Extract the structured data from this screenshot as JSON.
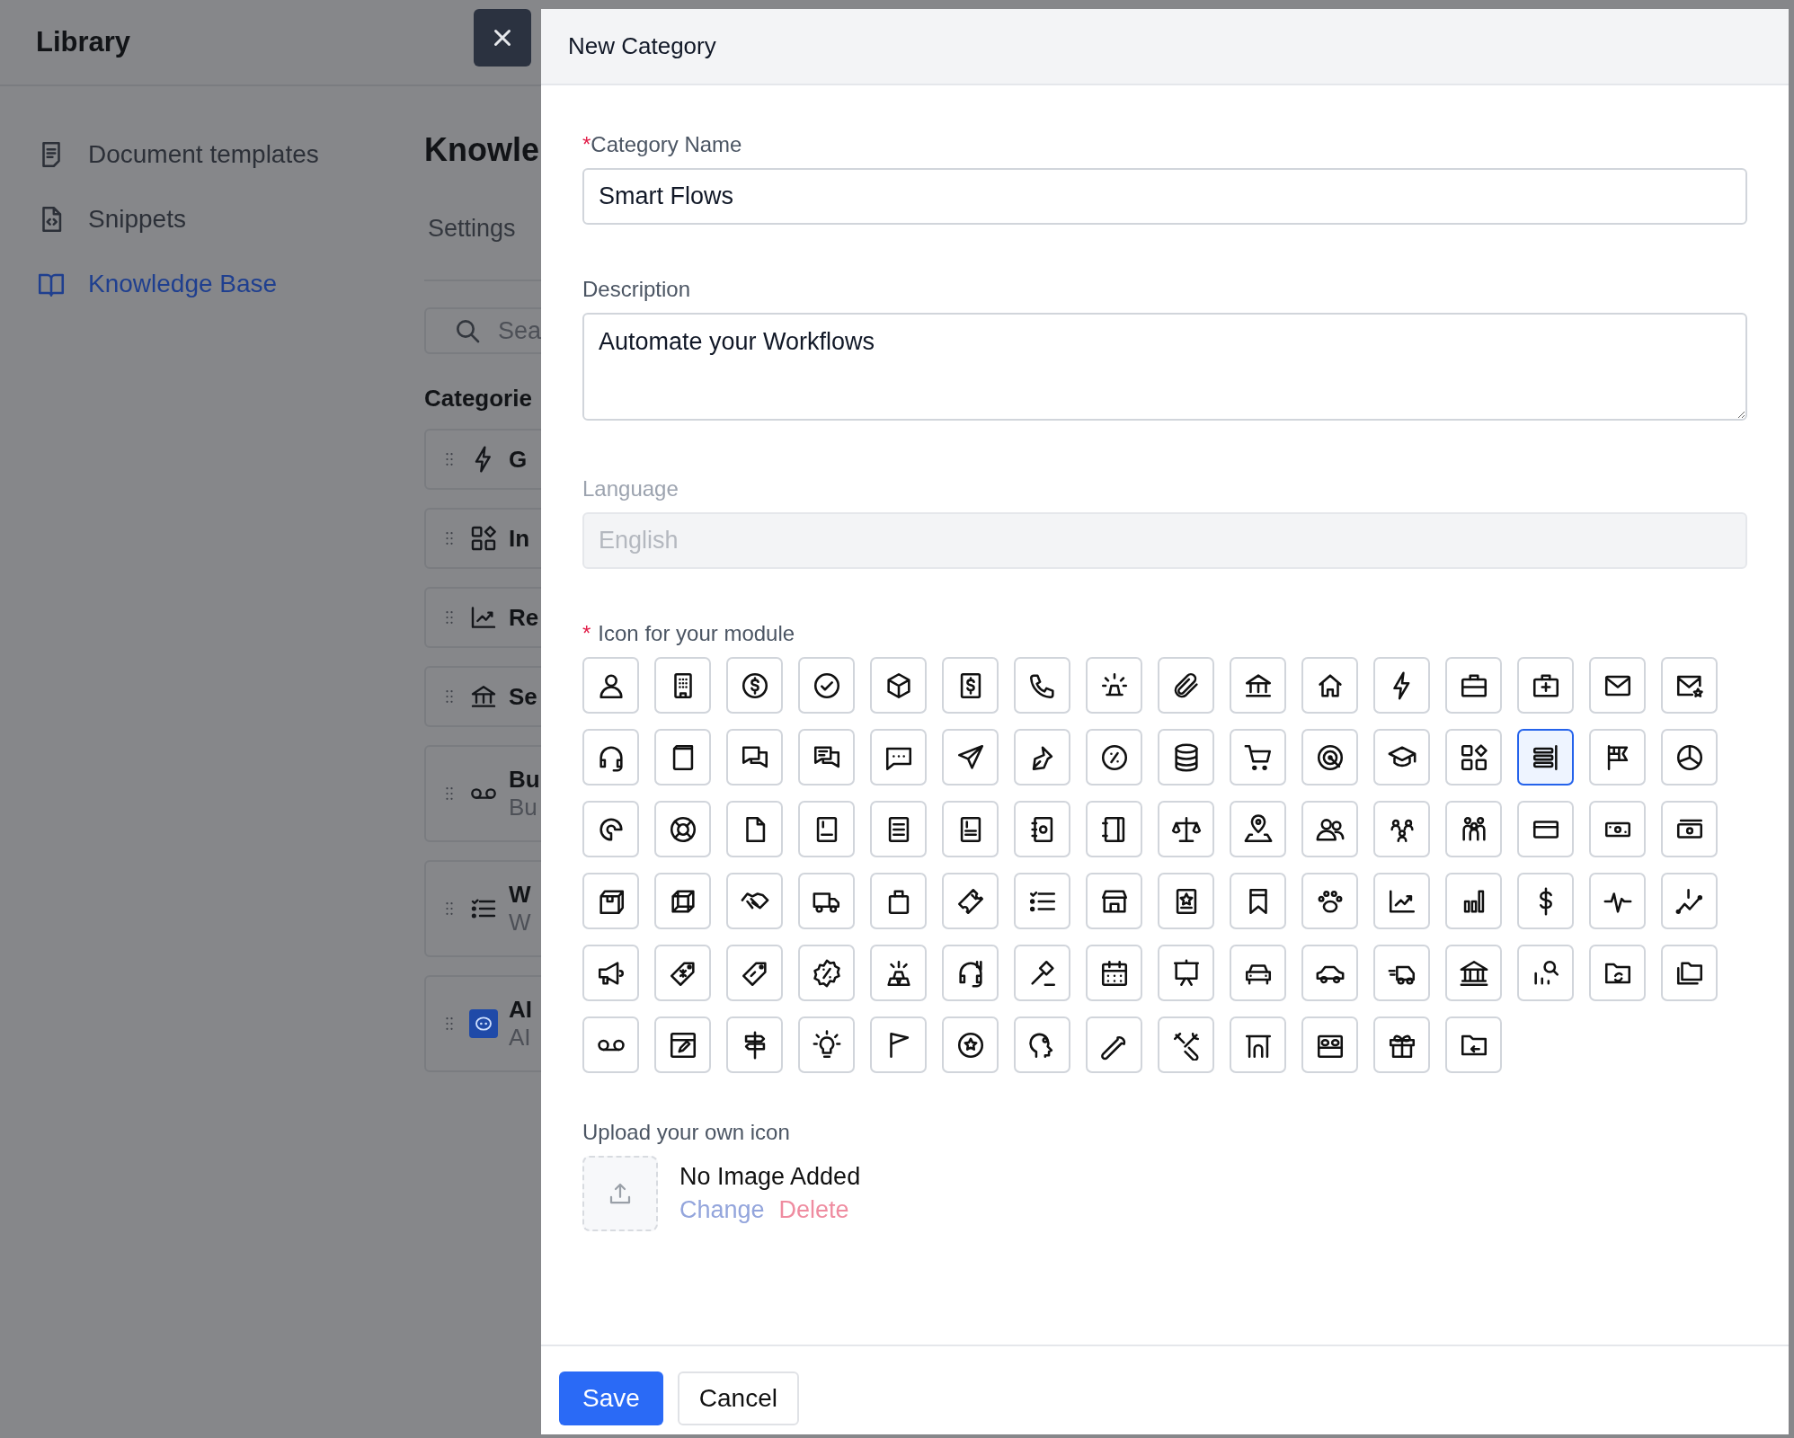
{
  "sidebar": {
    "title": "Library",
    "items": [
      {
        "label": "Document templates",
        "selected": false
      },
      {
        "label": "Snippets",
        "selected": false
      },
      {
        "label": "Knowledge Base",
        "selected": true
      }
    ]
  },
  "page": {
    "heading": "Knowle",
    "tabs": [
      {
        "label": "Settings"
      }
    ],
    "search": {
      "placeholder": "Sea"
    },
    "categories_heading": "Categorie",
    "categories": [
      {
        "title": "G"
      },
      {
        "title": "In"
      },
      {
        "title": "Re"
      },
      {
        "title": "Se"
      },
      {
        "title": "Bu",
        "subtitle": "Bu"
      },
      {
        "title": "W",
        "subtitle": "W"
      },
      {
        "title": "AI",
        "subtitle": "AI"
      }
    ]
  },
  "drawer": {
    "title": "New Category",
    "fields": [
      {
        "label": "Category Name",
        "marker": "*",
        "value": "Smart Flows",
        "kind": "text",
        "disabled": false
      },
      {
        "label": "Description",
        "value": "Automate your Workflows",
        "kind": "textarea",
        "disabled": false
      },
      {
        "label": "Language",
        "value": "English",
        "kind": "text",
        "disabled": true
      }
    ],
    "icon_picker": {
      "label": "Icon for your module",
      "marker": "*",
      "icons": [
        {
          "selected": false
        },
        {
          "selected": false
        },
        {
          "selected": false
        },
        {
          "selected": false
        },
        {
          "selected": false
        },
        {
          "selected": false
        },
        {
          "selected": false
        },
        {
          "selected": false
        },
        {
          "selected": false
        },
        {
          "selected": false
        },
        {
          "selected": false
        },
        {
          "selected": false
        },
        {
          "selected": false
        },
        {
          "selected": false
        },
        {
          "selected": false
        },
        {
          "selected": false
        },
        {
          "selected": false
        },
        {
          "selected": false
        },
        {
          "selected": false
        },
        {
          "selected": false
        },
        {
          "selected": false
        },
        {
          "selected": false
        },
        {
          "selected": false
        },
        {
          "selected": false
        },
        {
          "selected": false
        },
        {
          "selected": false
        },
        {
          "selected": false
        },
        {
          "selected": false
        },
        {
          "selected": false
        },
        {
          "selected": true
        },
        {
          "selected": false
        },
        {
          "selected": false
        },
        {
          "selected": false
        },
        {
          "selected": false
        },
        {
          "selected": false
        },
        {
          "selected": false
        },
        {
          "selected": false
        },
        {
          "selected": false
        },
        {
          "selected": false
        },
        {
          "selected": false
        },
        {
          "selected": false
        },
        {
          "selected": false
        },
        {
          "selected": false
        },
        {
          "selected": false
        },
        {
          "selected": false
        },
        {
          "selected": false
        },
        {
          "selected": false
        },
        {
          "selected": false
        },
        {
          "selected": false
        },
        {
          "selected": false
        },
        {
          "selected": false
        },
        {
          "selected": false
        },
        {
          "selected": false
        },
        {
          "selected": false
        },
        {
          "selected": false
        },
        {
          "selected": false
        },
        {
          "selected": false
        },
        {
          "selected": false
        },
        {
          "selected": false
        },
        {
          "selected": false
        },
        {
          "selected": false
        },
        {
          "selected": false
        },
        {
          "selected": false
        },
        {
          "selected": false
        },
        {
          "selected": false
        },
        {
          "selected": false
        },
        {
          "selected": false
        },
        {
          "selected": false
        },
        {
          "selected": false
        },
        {
          "selected": false
        },
        {
          "selected": false
        },
        {
          "selected": false
        },
        {
          "selected": false
        },
        {
          "selected": false
        },
        {
          "selected": false
        },
        {
          "selected": false
        },
        {
          "selected": false
        },
        {
          "selected": false
        },
        {
          "selected": false
        },
        {
          "selected": false
        },
        {
          "selected": false
        },
        {
          "selected": false
        },
        {
          "selected": false
        },
        {
          "selected": false
        },
        {
          "selected": false
        },
        {
          "selected": false
        },
        {
          "selected": false
        },
        {
          "selected": false
        },
        {
          "selected": false
        },
        {
          "selected": false
        },
        {
          "selected": false
        },
        {
          "selected": false
        },
        {
          "selected": false
        }
      ]
    },
    "upload": {
      "label": "Upload your own icon",
      "status": "No Image Added",
      "actions": [
        {
          "label": "Change",
          "kind": "change",
          "disabled": true
        },
        {
          "label": "Delete",
          "kind": "delete",
          "disabled": true
        }
      ]
    },
    "buttons": [
      {
        "label": "Save",
        "kind": "primary"
      },
      {
        "label": "Cancel",
        "kind": "secondary"
      }
    ]
  }
}
